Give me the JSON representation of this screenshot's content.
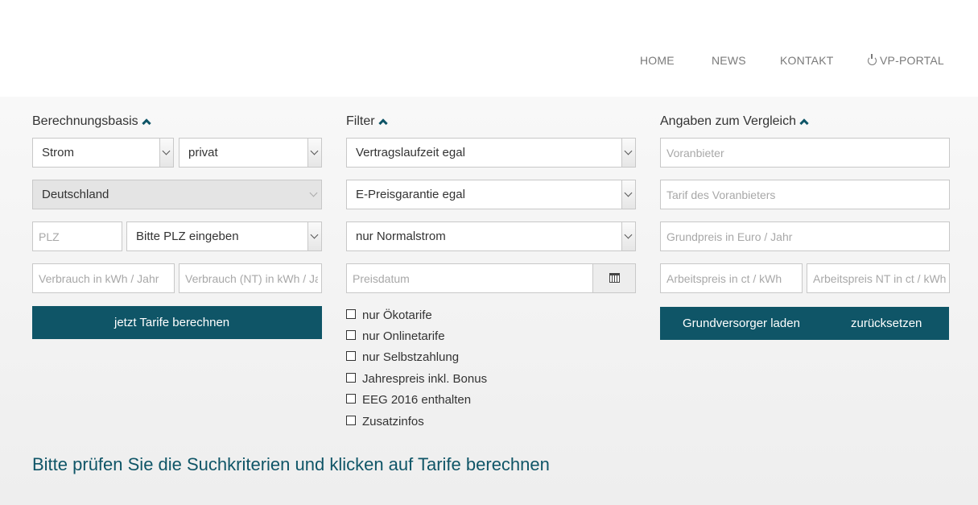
{
  "nav": {
    "home": "HOME",
    "news": "NEWS",
    "kontakt": "KONTAKT",
    "vp_portal": "VP-PORTAL"
  },
  "berechnungsbasis": {
    "heading": "Berechnungsbasis",
    "energy_type": "Strom",
    "customer_type": "privat",
    "country": "Deutschland",
    "plz_placeholder": "PLZ",
    "plz_select": "Bitte PLZ eingeben",
    "verbrauch_placeholder": "Verbrauch in kWh / Jahr",
    "verbrauch_nt_placeholder": "Verbrauch (NT) in kWh / Jahr",
    "calculate_button": "jetzt Tarife berechnen"
  },
  "filter": {
    "heading": "Filter",
    "vertragslaufzeit": "Vertragslaufzeit egal",
    "preisgarantie": "E-Preisgarantie egal",
    "stromart": "nur Normalstrom",
    "preisdatum_placeholder": "Preisdatum",
    "checkboxes": [
      "nur Ökotarife",
      "nur Onlinetarife",
      "nur Selbstzahlung",
      "Jahrespreis inkl. Bonus",
      "EEG 2016 enthalten",
      "Zusatzinfos"
    ]
  },
  "vergleich": {
    "heading": "Angaben zum Vergleich",
    "voranbieter_placeholder": "Voranbieter",
    "tarif_placeholder": "Tarif des Voranbieters",
    "grundpreis_placeholder": "Grundpreis in Euro / Jahr",
    "arbeitspreis_placeholder": "Arbeitspreis in ct / kWh",
    "arbeitspreis_nt_placeholder": "Arbeitspreis NT in ct / kWh",
    "load_button": "Grundversorger laden",
    "reset_button": "zurücksetzen"
  },
  "message": "Bitte prüfen Sie die Suchkriterien und klicken auf Tarife berechnen",
  "colors": {
    "accent": "#0f5567"
  }
}
